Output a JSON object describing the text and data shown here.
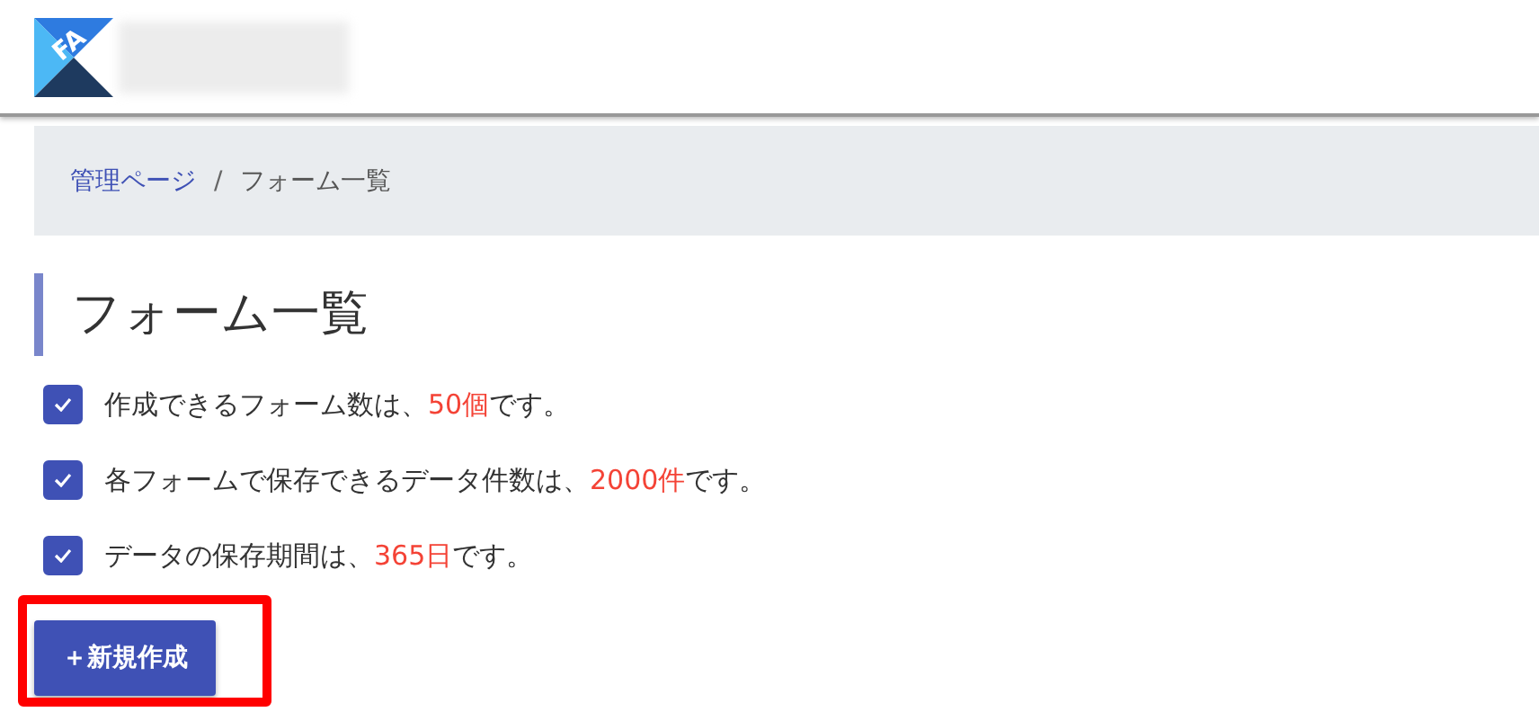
{
  "header": {
    "logo_text": "FA"
  },
  "breadcrumb": [
    {
      "label": "管理ページ",
      "kind": "link"
    },
    {
      "label": "フォーム一覧",
      "kind": "current"
    }
  ],
  "breadcrumb_separator": "/",
  "title": "フォーム一覧",
  "notes": [
    {
      "checked": true,
      "before": "作成できるフォーム数は、",
      "highlight": "50個",
      "after": "です。"
    },
    {
      "checked": true,
      "before": "各フォームで保存できるデータ件数は、",
      "highlight": "2000件",
      "after": "です。"
    },
    {
      "checked": true,
      "before": "データの保存期間は、",
      "highlight": "365日",
      "after": "です。"
    }
  ],
  "new_button": {
    "label": "＋新規作成",
    "highlighted": true
  }
}
